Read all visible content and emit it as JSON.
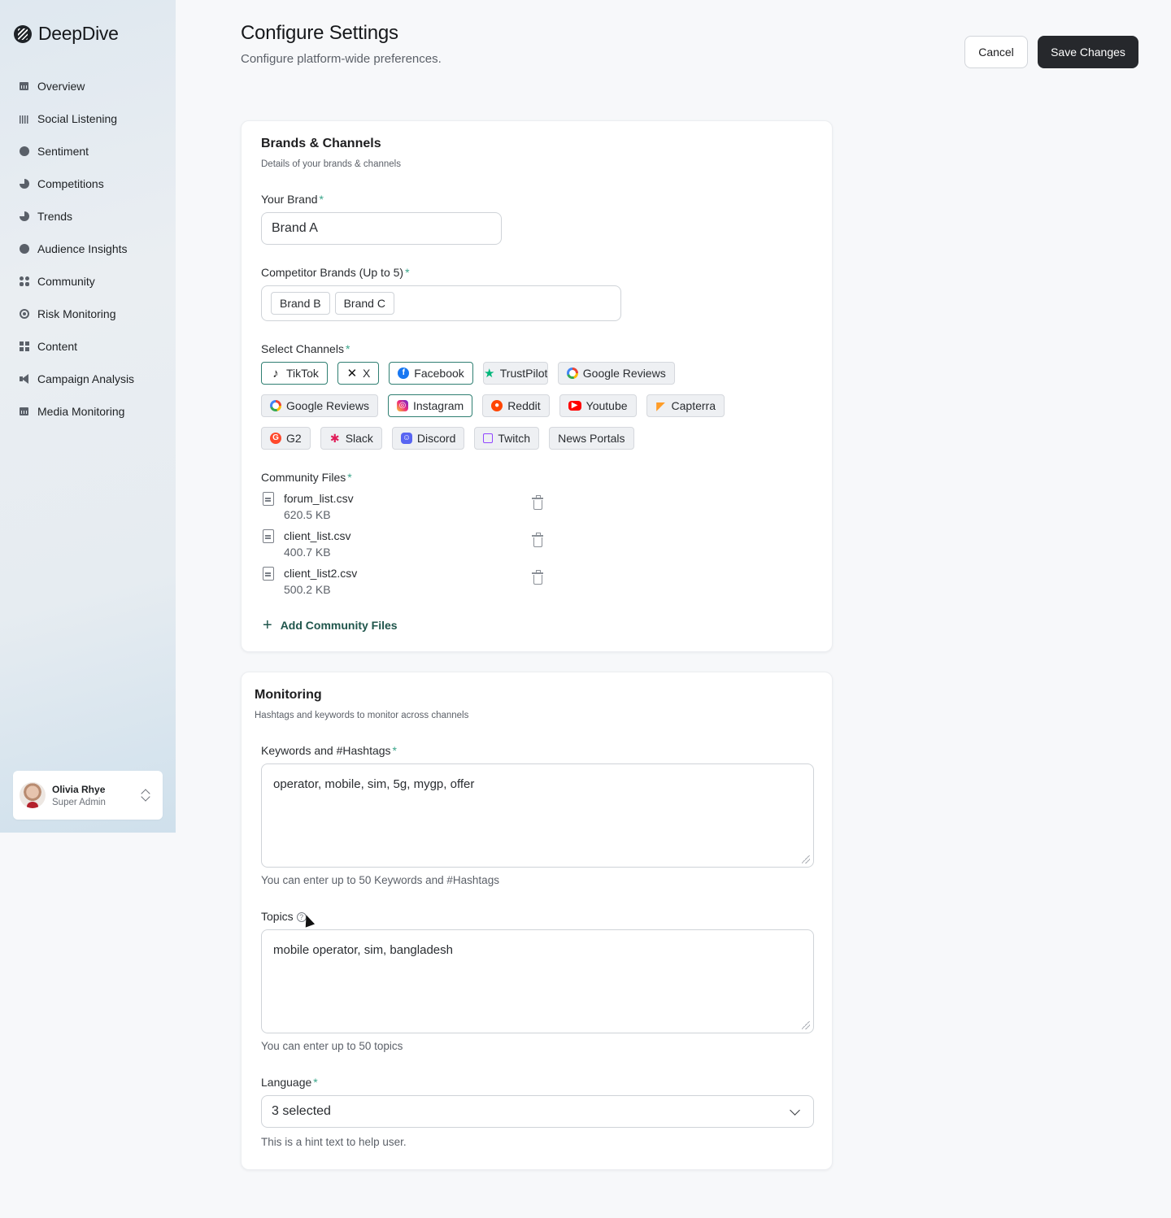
{
  "app": {
    "name": "DeepDive"
  },
  "sidebar": {
    "items": [
      {
        "label": "Overview",
        "icon": "bar-chart-icon"
      },
      {
        "label": "Social Listening",
        "icon": "soundwave-icon"
      },
      {
        "label": "Sentiment",
        "icon": "smile-icon"
      },
      {
        "label": "Competitions",
        "icon": "pie-chart-icon"
      },
      {
        "label": "Trends",
        "icon": "trend-icon"
      },
      {
        "label": "Audience Insights",
        "icon": "audience-icon"
      },
      {
        "label": "Community",
        "icon": "community-icon"
      },
      {
        "label": "Risk Monitoring",
        "icon": "radar-icon"
      },
      {
        "label": "Content",
        "icon": "grid-icon"
      },
      {
        "label": "Campaign Analysis",
        "icon": "megaphone-icon"
      },
      {
        "label": "Media Monitoring",
        "icon": "media-icon"
      }
    ],
    "user": {
      "name": "Olivia Rhye",
      "role": "Super Admin"
    }
  },
  "header": {
    "title": "Configure Settings",
    "subtitle": "Configure platform-wide preferences.",
    "cancel_label": "Cancel",
    "save_label": "Save Changes"
  },
  "brands": {
    "title": "Brands & Channels",
    "description": "Details of your brands & channels",
    "your_brand_label": "Your Brand",
    "your_brand_value": "Brand A",
    "competitor_label": "Competitor Brands (Up to 5)",
    "competitors": [
      "Brand B",
      "Brand C"
    ],
    "channels_label": "Select Channels",
    "channels": [
      {
        "label": "TikTok",
        "selected": true,
        "icon": "tiktok-icon"
      },
      {
        "label": "X",
        "selected": true,
        "icon": "x-icon"
      },
      {
        "label": "Facebook",
        "selected": true,
        "icon": "facebook-icon"
      },
      {
        "label": "TrustPilot",
        "selected": false,
        "icon": "trustpilot-icon"
      },
      {
        "label": "Google Reviews",
        "selected": false,
        "icon": "google-icon"
      },
      {
        "label": "Google Reviews",
        "selected": false,
        "icon": "google-icon"
      },
      {
        "label": "Instagram",
        "selected": true,
        "icon": "instagram-icon"
      },
      {
        "label": "Reddit",
        "selected": false,
        "icon": "reddit-icon"
      },
      {
        "label": "Youtube",
        "selected": false,
        "icon": "youtube-icon"
      },
      {
        "label": "Capterra",
        "selected": false,
        "icon": "capterra-icon"
      },
      {
        "label": "G2",
        "selected": false,
        "icon": "g2-icon"
      },
      {
        "label": "Slack",
        "selected": false,
        "icon": "slack-icon"
      },
      {
        "label": "Discord",
        "selected": false,
        "icon": "discord-icon"
      },
      {
        "label": "Twitch",
        "selected": false,
        "icon": "twitch-icon"
      },
      {
        "label": "News Portals",
        "selected": false,
        "icon": ""
      }
    ],
    "community_files_label": "Community Files",
    "files": [
      {
        "name": "forum_list.csv",
        "size": "620.5 KB"
      },
      {
        "name": "client_list.csv",
        "size": "400.7 KB"
      },
      {
        "name": "client_list2.csv",
        "size": "500.2 KB"
      }
    ],
    "add_files_label": "Add Community Files"
  },
  "monitoring": {
    "title": "Monitoring",
    "description": "Hashtags and keywords to monitor across channels",
    "keywords_label": "Keywords and #Hashtags",
    "keywords_value": "operator, mobile, sim, 5g, mygp, offer",
    "keywords_hint": "You can enter up to 50 Keywords and #Hashtags",
    "topics_label": "Topics",
    "topics_value": "mobile operator, sim, bangladesh",
    "topics_hint": "You can enter up to 50 topics",
    "language_label": "Language",
    "language_value": "3 selected",
    "language_hint": "This is a hint text to help user."
  },
  "colors": {
    "accent": "#2f7f72",
    "required": "#3aa58a",
    "primary_button": "#26282c"
  }
}
